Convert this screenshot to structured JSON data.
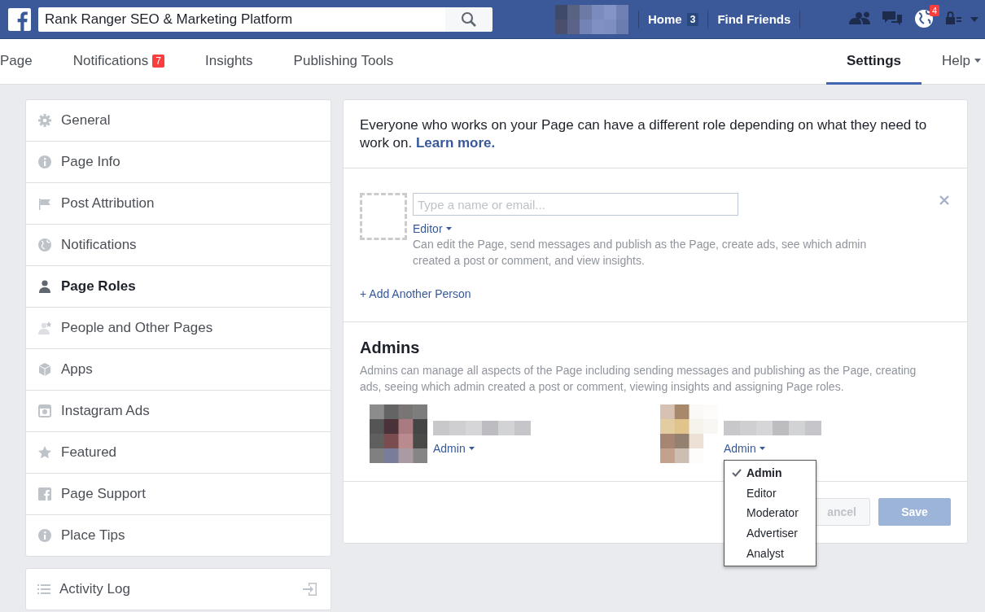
{
  "header": {
    "search": {
      "value": "Rank Ranger SEO & Marketing Platform"
    },
    "nav": [
      {
        "label": "Home",
        "count": "3"
      },
      {
        "label": "Find Friends"
      }
    ],
    "icons": [
      {
        "kind": "friends"
      },
      {
        "kind": "messages"
      },
      {
        "kind": "globe",
        "badge": "4"
      },
      {
        "kind": "privacy"
      }
    ]
  },
  "tabs": [
    {
      "label": "Page",
      "selected": false
    },
    {
      "label": "Notifications",
      "badge": "7",
      "selected": false
    },
    {
      "label": "Insights",
      "selected": false
    },
    {
      "label": "Publishing Tools",
      "selected": false
    }
  ],
  "right_tabs": [
    {
      "label": "Settings",
      "selected": true
    },
    {
      "label": "Help",
      "menu": true,
      "selected": false
    }
  ],
  "sidebar": {
    "items": [
      {
        "label": "General",
        "kind": "gear",
        "selected": false
      },
      {
        "label": "Page Info",
        "kind": "info",
        "selected": false
      },
      {
        "label": "Post Attribution",
        "kind": "flag",
        "selected": false
      },
      {
        "label": "Notifications",
        "kind": "globe",
        "selected": false
      },
      {
        "label": "Page Roles",
        "kind": "person",
        "selected": true
      },
      {
        "label": "People and Other Pages",
        "kind": "person-star",
        "selected": false
      },
      {
        "label": "Apps",
        "kind": "cube",
        "selected": false
      },
      {
        "label": "Instagram Ads",
        "kind": "camera",
        "selected": false
      },
      {
        "label": "Featured",
        "kind": "star",
        "selected": false
      },
      {
        "label": "Page Support",
        "kind": "fb",
        "selected": false
      },
      {
        "label": "Place Tips",
        "kind": "info",
        "selected": false
      }
    ],
    "activity_log": {
      "label": "Activity Log"
    }
  },
  "roles": {
    "intro": {
      "text": "Everyone who works on your Page can have a different role depending on what they need to work on.",
      "link": "Learn more."
    },
    "new_person": {
      "placeholder": "Type a name or email...",
      "role": "Editor",
      "description": "Can edit the Page, send messages and publish as the Page, create ads, see which admin created a post or comment, and view insights."
    },
    "add_link": "+ Add Another Person",
    "admins": {
      "title": "Admins",
      "description": "Admins can manage all aspects of the Page including sending messages and publishing as the Page, creating ads, seeing which admin created a post or comment, viewing insights and assigning Page roles.",
      "people": [
        {
          "role": "Admin"
        },
        {
          "role": "Admin",
          "role_menu": [
            {
              "label": "Admin",
              "selected": true
            },
            {
              "label": "Editor",
              "selected": false
            },
            {
              "label": "Moderator",
              "selected": false
            },
            {
              "label": "Advertiser",
              "selected": false
            },
            {
              "label": "Analyst",
              "selected": false
            }
          ]
        }
      ]
    },
    "buttons": [
      {
        "label": "ancel",
        "kind": "cancel",
        "disabled": true
      },
      {
        "label": "Save",
        "kind": "save",
        "disabled": true
      }
    ]
  }
}
